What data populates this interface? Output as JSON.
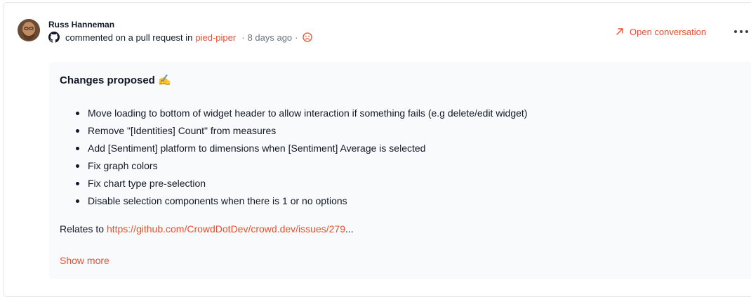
{
  "activity": {
    "author": "Russ Hanneman",
    "action": "commented on a pull request in",
    "repo": "pied-piper",
    "separator": "·",
    "time_ago": "8 days ago",
    "sentiment_icon": "frown-face-icon",
    "platform_icon": "github-icon"
  },
  "actions": {
    "open_conversation": "Open conversation",
    "more_icon": "ellipsis-icon"
  },
  "content": {
    "heading": "Changes proposed ✍️",
    "bullets": [
      "Move loading to bottom of widget header to allow interaction if something fails (e.g delete/edit widget)",
      "Remove \"[Identities] Count\" from measures",
      "Add [Sentiment] platform to dimensions when [Sentiment] Average is selected",
      "Fix graph colors",
      "Fix chart type pre-selection",
      "Disable selection components when there is 1 or no options"
    ],
    "relates_prefix": "Relates to ",
    "relates_url": "https://github.com/CrowdDotDev/crowd.dev/issues/279",
    "relates_suffix": "...",
    "show_more": "Show more"
  },
  "colors": {
    "accent": "#e94f2e",
    "text": "#111827",
    "muted": "#6b7280",
    "content_bg": "#f9fafb"
  }
}
